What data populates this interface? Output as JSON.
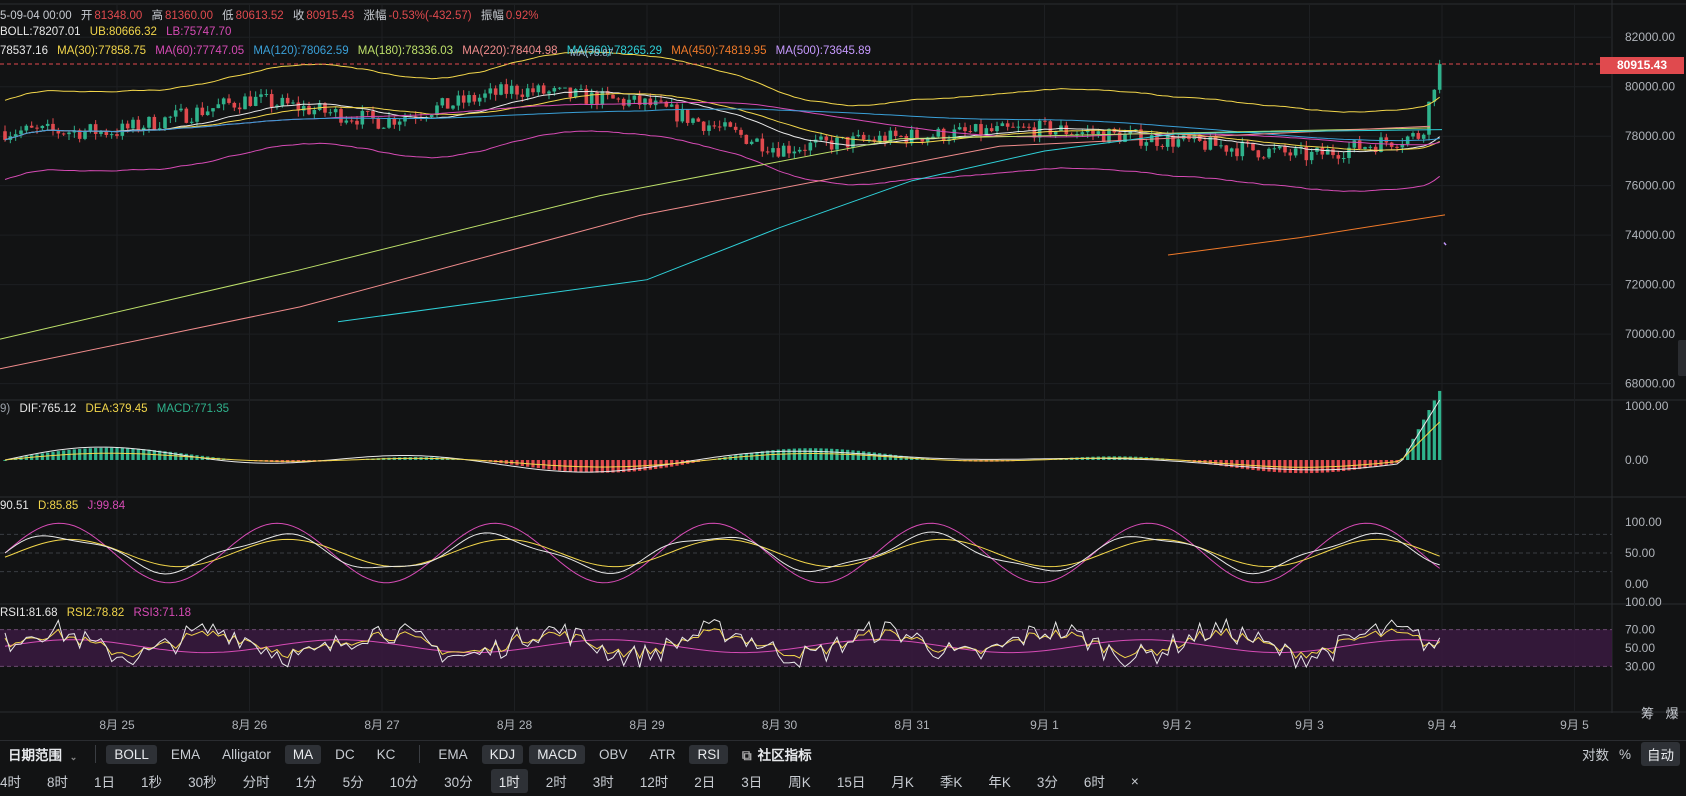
{
  "header": {
    "date": "5-09-04 00:00",
    "open_label": "开",
    "open": "81348.00",
    "high_label": "高",
    "high": "81360.00",
    "low_label": "低",
    "low": "80613.52",
    "close_label": "收",
    "close": "80915.43",
    "change_label": "涨幅",
    "change": "-0.53%(-432.57)",
    "amp_label": "振幅",
    "amp": "0.92%"
  },
  "boll_legend": {
    "boll": "BOLL:78207.01",
    "ub": "UB:80666.32",
    "lb": "LB:75747.70"
  },
  "ma_legend": {
    "ma_lead": "78537.16",
    "ma30": "MA(30):77858.75",
    "ma60": "MA(60):77747.05",
    "ma120": "MA(120):78062.59",
    "ma180": "MA(180):78336.03",
    "ma220": "MA(220):78404.98",
    "ma360": "MA(360):78265.29",
    "ma450": "MA(450):74819.95",
    "ma500": "MA(500):73645.89",
    "ma_overlay": "MA(78.87"
  },
  "macd_legend": {
    "lead": "9)",
    "dif": "DIF:765.12",
    "dea": "DEA:379.45",
    "macd": "MACD:771.35"
  },
  "kdj_legend": {
    "k": "90.51",
    "d": "D:85.85",
    "j": "J:99.84"
  },
  "rsi_legend": {
    "rsi1": "RSI1:81.68",
    "rsi2": "RSI2:78.82",
    "rsi3": "RSI3:71.18"
  },
  "current_price": "80915.43",
  "price_axis": [
    "82000.00",
    "80000.00",
    "78000.00",
    "76000.00",
    "74000.00",
    "72000.00",
    "70000.00",
    "68000.00"
  ],
  "macd_axis": [
    "1000.00",
    "0.00"
  ],
  "kdj_axis": [
    "100.00",
    "50.00",
    "0.00"
  ],
  "rsi_axis": [
    "100.00",
    "70.00",
    "50.00",
    "30.00"
  ],
  "x_dates": [
    "8月 25",
    "8月 26",
    "8月 27",
    "8月 28",
    "8月 29",
    "8月 30",
    "8月 31",
    "9月 1",
    "9月 2",
    "9月 3",
    "9月 4",
    "9月 5"
  ],
  "indicator_bar": {
    "date_range": "日期范围",
    "overlays": [
      {
        "label": "BOLL",
        "active": true
      },
      {
        "label": "EMA",
        "active": false
      },
      {
        "label": "Alligator",
        "active": false
      },
      {
        "label": "MA",
        "active": true
      },
      {
        "label": "DC",
        "active": false
      },
      {
        "label": "KC",
        "active": false
      }
    ],
    "subs": [
      {
        "label": "EMA",
        "active": false
      },
      {
        "label": "KDJ",
        "active": true
      },
      {
        "label": "MACD",
        "active": true
      },
      {
        "label": "OBV",
        "active": false
      },
      {
        "label": "ATR",
        "active": false
      },
      {
        "label": "RSI",
        "active": true
      }
    ],
    "community": "社区指标",
    "log_label": "对数",
    "pct_label": "%",
    "auto_label": "自动"
  },
  "timeframes": [
    "4时",
    "8时",
    "1日",
    "1秒",
    "30秒",
    "分时",
    "1分",
    "5分",
    "10分",
    "30分",
    "1时",
    "2时",
    "3时",
    "12时",
    "2日",
    "3日",
    "周K",
    "15日",
    "月K",
    "季K",
    "年K",
    "3分",
    "6时"
  ],
  "active_timeframe": "1时",
  "close_glyph": "×",
  "side_labels": [
    "筹",
    "爆"
  ],
  "colors": {
    "up": "#2fb28c",
    "down": "#e04a4e",
    "bg": "#121314",
    "boll_mid": "#e8e8e8",
    "boll_ub": "#f2d64b",
    "boll_lb": "#d64bb5",
    "ma30": "#f2d64b",
    "ma60": "#d64bb5",
    "ma120": "#3aa0d8",
    "ma180": "#bde06a",
    "ma220": "#f08c8c",
    "ma360": "#2fd0d8",
    "ma450": "#f07a2a",
    "ma500": "#c79aff"
  },
  "chart_data": {
    "type": "line",
    "x": [
      "8月 25",
      "8月 26",
      "8月 27",
      "8月 28",
      "8月 29",
      "8月 30",
      "8月 31",
      "9月 1",
      "9月 2",
      "9月 3",
      "9月 4"
    ],
    "series": [
      {
        "name": "BOLL",
        "values": [
          78200,
          79500,
          78600,
          79900,
          79300,
          77500,
          78000,
          78300,
          77800,
          77200,
          78207
        ]
      },
      {
        "name": "MA(360)",
        "values": [
          null,
          null,
          null,
          70100,
          72200,
          74300,
          76200,
          77400,
          78100,
          78200,
          78265
        ]
      },
      {
        "name": "MA(450)",
        "values": [
          null,
          null,
          null,
          null,
          null,
          null,
          null,
          null,
          73200,
          73800,
          74820
        ]
      }
    ],
    "price_range": [
      67500,
      83100
    ],
    "close": 80915.43,
    "grid": true
  }
}
